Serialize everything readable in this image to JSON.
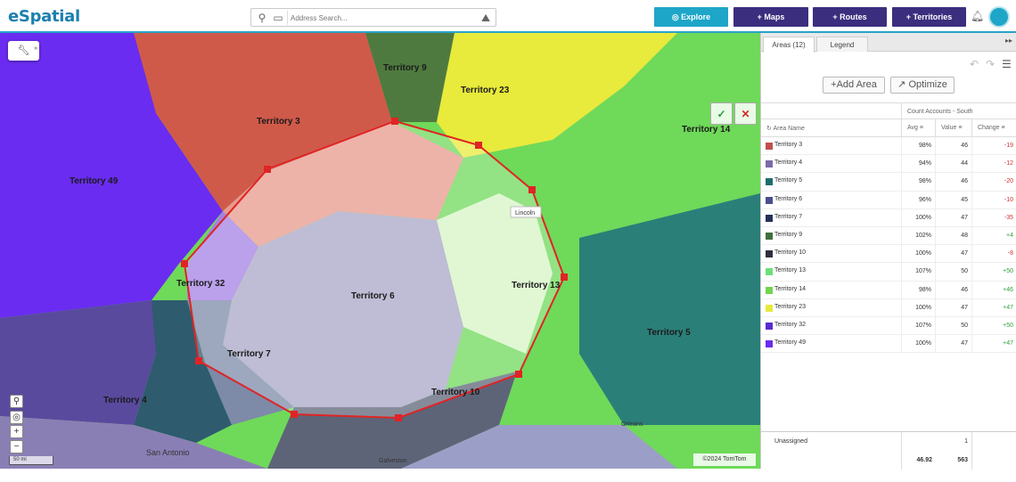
{
  "app": {
    "logo": "eSpatial"
  },
  "search": {
    "placeholder": "Address Search..."
  },
  "toolbar": {
    "explore": "Explore",
    "maps": "+ Maps",
    "routes": "+ Routes",
    "territories": "+ Territories"
  },
  "map": {
    "territory_labels": [
      "Territory 9",
      "Territory 23",
      "Territory 3",
      "Territory 14",
      "Territory 49",
      "Territory 32",
      "Territory 6",
      "Territory 13",
      "Territory 5",
      "Territory 7",
      "Territory 10",
      "Territory 4"
    ],
    "place_labels": [
      "Lincoln",
      "Orleans",
      "San Antonio",
      "Galveston"
    ],
    "scale": "50 mi",
    "copyright": "©2024 TomTom"
  },
  "panel": {
    "tabs": [
      "Areas (12)",
      "Legend"
    ],
    "add_area": "Add Area",
    "optimize": "Optimize",
    "group_header": "Count Accounts - South",
    "columns": {
      "name": "Area Name",
      "avg": "Avg",
      "value": "Value",
      "change": "Change"
    },
    "rows": [
      {
        "name": "Territory 3",
        "color": "#c0504d",
        "avg": "98%",
        "value": "46",
        "change": "-19"
      },
      {
        "name": "Territory 4",
        "color": "#7b6aa8",
        "avg": "94%",
        "value": "44",
        "change": "-12"
      },
      {
        "name": "Territory 5",
        "color": "#1d6e6a",
        "avg": "98%",
        "value": "46",
        "change": "-20"
      },
      {
        "name": "Territory 6",
        "color": "#4a4f8c",
        "avg": "96%",
        "value": "45",
        "change": "-10"
      },
      {
        "name": "Territory 7",
        "color": "#24305a",
        "avg": "100%",
        "value": "47",
        "change": "-35"
      },
      {
        "name": "Territory 9",
        "color": "#3f6f3c",
        "avg": "102%",
        "value": "48",
        "change": "+4"
      },
      {
        "name": "Territory 10",
        "color": "#2e2e3e",
        "avg": "100%",
        "value": "47",
        "change": "-8"
      },
      {
        "name": "Territory 13",
        "color": "#6be07a",
        "avg": "107%",
        "value": "50",
        "change": "+50"
      },
      {
        "name": "Territory 14",
        "color": "#72d44f",
        "avg": "98%",
        "value": "46",
        "change": "+46"
      },
      {
        "name": "Territory 23",
        "color": "#e6ea3c",
        "avg": "100%",
        "value": "47",
        "change": "+47"
      },
      {
        "name": "Territory 32",
        "color": "#5a2ad1",
        "avg": "107%",
        "value": "50",
        "change": "+50"
      },
      {
        "name": "Territory 49",
        "color": "#6a2cf0",
        "avg": "100%",
        "value": "47",
        "change": "+47"
      }
    ],
    "unassigned": {
      "label": "Unassigned",
      "value": "1"
    },
    "totals": {
      "avg": "46.92",
      "value": "563"
    }
  }
}
